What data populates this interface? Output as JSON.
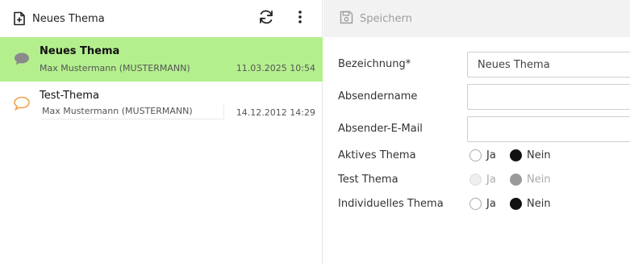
{
  "list_toolbar": {
    "new_label": "Neues Thema"
  },
  "detail_toolbar": {
    "save_label": "Speichern"
  },
  "items": [
    {
      "title": "Neues Thema",
      "author": "Max Mustermann (MUSTERMANN)",
      "date": "11.03.2025 10:54",
      "selected": true,
      "icon": "speech-bubble-filled-icon"
    },
    {
      "title": "Test-Thema",
      "author": "Max Mustermann (MUSTERMANN)",
      "date": "14.12.2012 14:29",
      "selected": false,
      "icon": "speech-bubble-outline-icon"
    }
  ],
  "form": {
    "name": {
      "label": "Bezeichnung*",
      "value": "Neues Thema"
    },
    "sender_name": {
      "label": "Absendername",
      "value": ""
    },
    "sender_email": {
      "label": "Absender-E-Mail",
      "value": ""
    },
    "active": {
      "label": "Aktives Thema",
      "yes": "Ja",
      "no": "Nein",
      "selected": "Nein"
    },
    "test": {
      "label": "Test Thema",
      "yes": "Ja",
      "no": "Nein",
      "selected": "Nein",
      "disabled": true
    },
    "individual": {
      "label": "Individuelles Thema",
      "yes": "Ja",
      "no": "Nein",
      "selected": "Nein"
    }
  },
  "colors": {
    "selected_row": "#b4ef8e",
    "item_icon_active": "#8a8a8a",
    "item_icon_inactive": "#f0a24a"
  }
}
